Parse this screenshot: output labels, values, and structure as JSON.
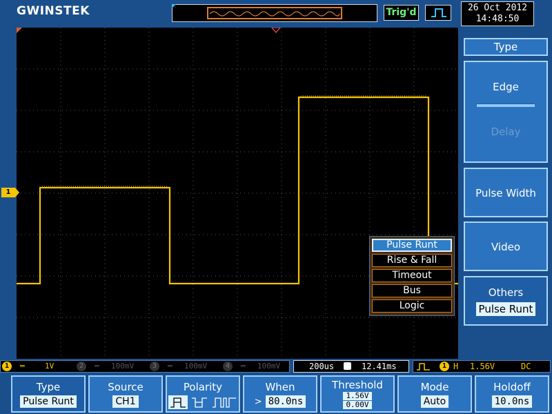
{
  "header": {
    "brand": "GWINSTEK",
    "trigger_status": "Trig'd",
    "date": "26 Oct 2012",
    "time": "14:48:50"
  },
  "channel_status": {
    "ch1": {
      "number": "1",
      "scale": "1V"
    },
    "ch2": {
      "number": "2",
      "scale": "100mV"
    },
    "ch3": {
      "number": "3",
      "scale": "100mV"
    },
    "ch4": {
      "number": "4",
      "scale": "100mV"
    }
  },
  "timebase": {
    "scale": "200us",
    "position": "12.41ms"
  },
  "trigger_info": {
    "channel": "1",
    "label": "H",
    "level": "1.56V",
    "coupling": "DC"
  },
  "waveform": {
    "channel": "CH1",
    "color": "#f3c400",
    "marker": "1"
  },
  "side_menu": {
    "title": "Type",
    "edge": "Edge",
    "delay": "Delay",
    "pulse_width": "Pulse Width",
    "video": "Video",
    "others_label": "Others",
    "others_value": "Pulse Runt"
  },
  "others_popup": {
    "items": [
      "Pulse Runt",
      "Rise & Fall",
      "Timeout",
      "Bus",
      "Logic"
    ],
    "selected": "Pulse Runt"
  },
  "softkeys": {
    "type": {
      "label": "Type",
      "value": "Pulse Runt"
    },
    "source": {
      "label": "Source",
      "value": "CH1"
    },
    "polarity": {
      "label": "Polarity"
    },
    "when": {
      "label": "When",
      "prefix": ">",
      "value": "80.0ns"
    },
    "threshold": {
      "label": "Threshold",
      "high": "1.56V",
      "low": "0.00V"
    },
    "mode": {
      "label": "Mode",
      "value": "Auto"
    },
    "holdoff": {
      "label": "Holdoff",
      "value": "10.0ns"
    }
  },
  "colors": {
    "accent": "#2c73bf",
    "ch1": "#f3c400",
    "background": "#1b4f8c"
  }
}
